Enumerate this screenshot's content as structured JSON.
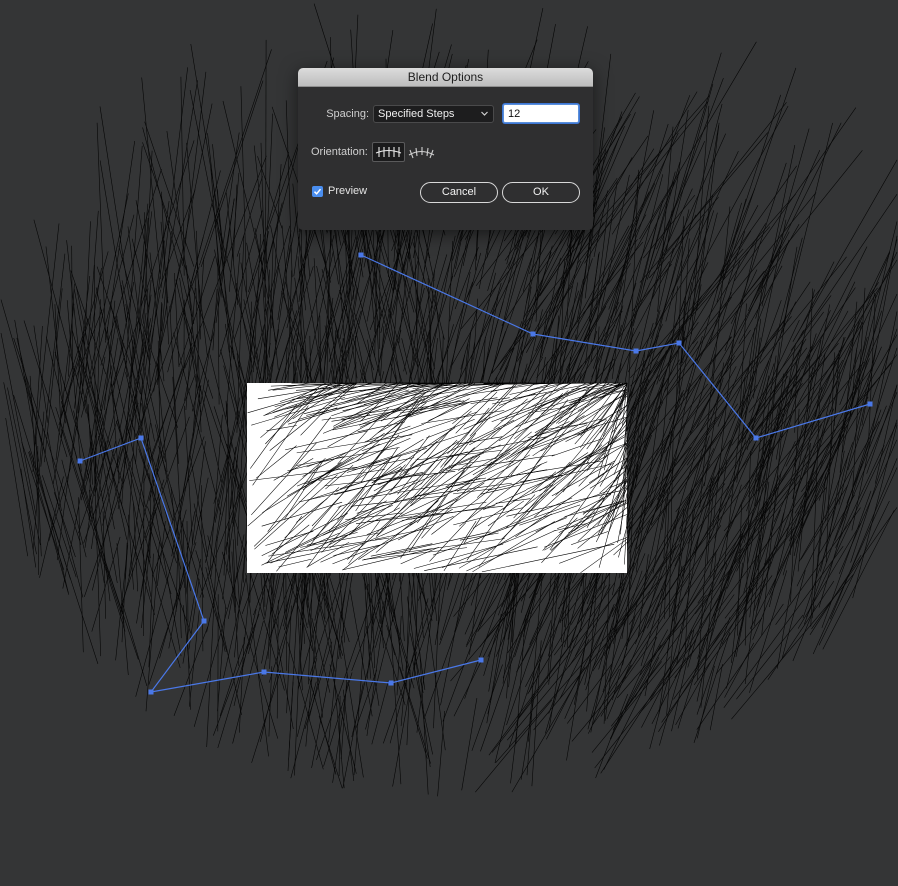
{
  "dialog": {
    "title": "Blend Options",
    "spacing": {
      "label": "Spacing:",
      "selected": "Specified Steps",
      "steps_value": "12"
    },
    "orientation": {
      "label": "Orientation:",
      "selected": "align-to-page"
    },
    "preview": {
      "label": "Preview",
      "checked": true
    },
    "cancel_label": "Cancel",
    "ok_label": "OK"
  },
  "icons": {
    "spacing_dropdown": "chevron-down-icon",
    "orientation_page": "align-to-page-icon",
    "orientation_path": "align-to-path-icon",
    "preview_check": "checkmark-icon"
  },
  "colors": {
    "canvas": "#343536",
    "selection_path": "#4a78e8",
    "anchor": "#4a78e8",
    "dialog_bg": "#2f2f30",
    "checkbox": "#4a8eef",
    "blend_strokes": "#000000",
    "inner_rect": "#ffffff"
  }
}
